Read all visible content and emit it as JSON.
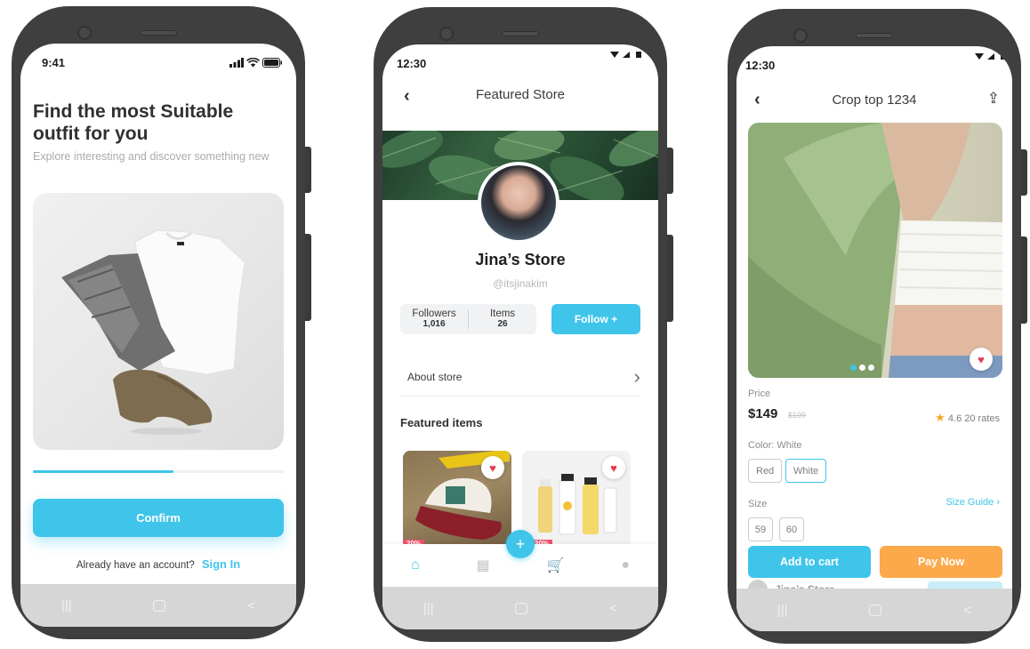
{
  "colors": {
    "accent": "#3fc4ea",
    "orange": "#fba94a",
    "heart": "#e53950"
  },
  "screen1": {
    "time": "9:41",
    "title": "Find the most Suitable outfit for you",
    "subtitle": "Explore interesting and discover something new",
    "progress": 0.56,
    "confirm_label": "Confirm",
    "account_prompt": "Already have an account?",
    "signin_label": "Sign In"
  },
  "screen2": {
    "time": "12:30",
    "back_icon": "chevron-left-icon",
    "title": "Featured Store",
    "store_name": "Jina’s Store",
    "handle": "@itsjinakim",
    "followers_label": "Followers",
    "followers_value": "1,016",
    "items_label": "Items",
    "items_value": "26",
    "follow_label": "Follow +",
    "about_label": "About store",
    "featured_label": "Featured items",
    "fab": "+",
    "item_discount": "20%",
    "tabs": [
      "home-icon",
      "grid-icon",
      "cart-icon",
      "user-icon"
    ]
  },
  "screen3": {
    "time": "12:30",
    "title": "Crop top 1234",
    "price_label": "Price",
    "price": "$149",
    "old_price": "$199",
    "rating": "4.6",
    "rates": "20 rates",
    "color_label": "Color: White",
    "colors": [
      "Red",
      "White"
    ],
    "selected_color": "White",
    "size_label": "Size",
    "size_guide": "Size Guide",
    "sizes": [
      "59",
      "60"
    ],
    "add_cart_label": "Add to cart",
    "pay_label": "Pay Now",
    "peek_store": "Jina’s Store"
  }
}
